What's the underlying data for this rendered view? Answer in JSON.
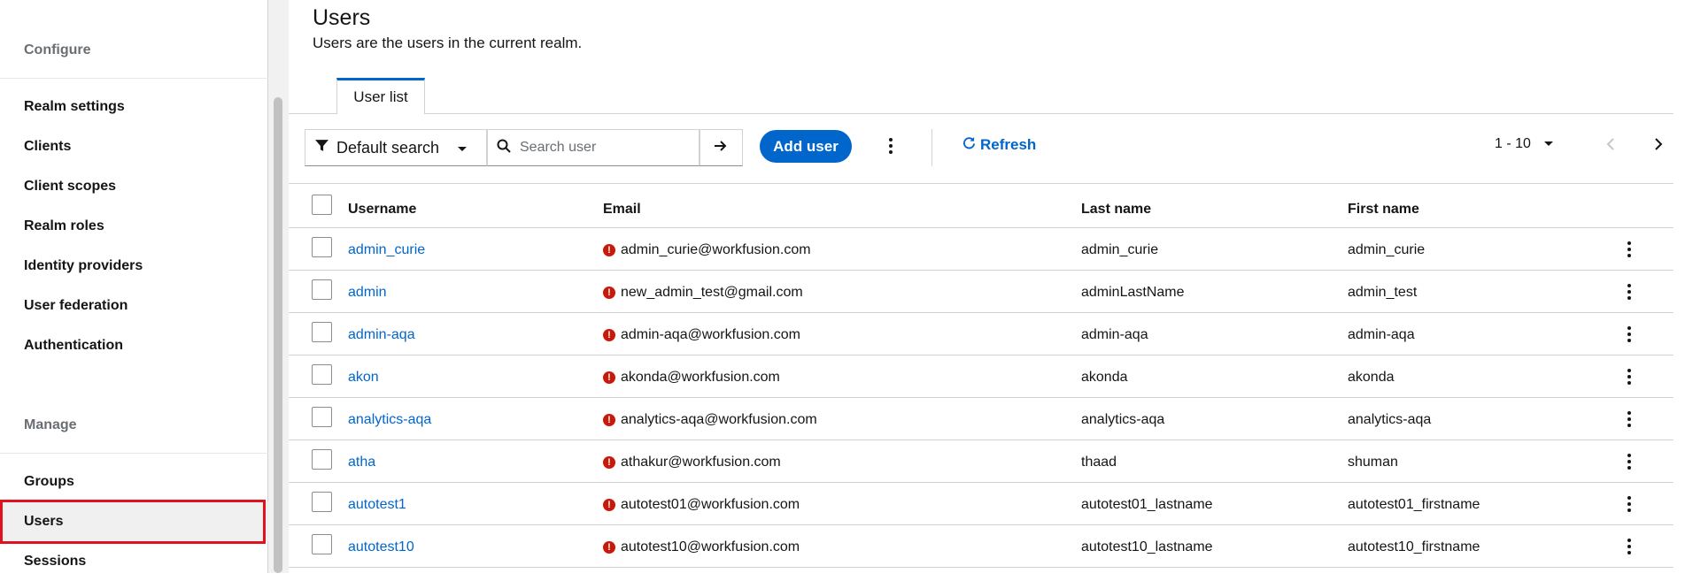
{
  "sidebar": {
    "configure_label": "Configure",
    "manage_label": "Manage",
    "configure_items": [
      {
        "label": "Realm settings"
      },
      {
        "label": "Clients"
      },
      {
        "label": "Client scopes"
      },
      {
        "label": "Realm roles"
      },
      {
        "label": "Identity providers"
      },
      {
        "label": "User federation"
      },
      {
        "label": "Authentication"
      }
    ],
    "manage_items": [
      {
        "label": "Groups"
      },
      {
        "label": "Users"
      },
      {
        "label": "Sessions"
      }
    ],
    "active_item": "Users"
  },
  "page": {
    "title": "Users",
    "subtitle": "Users are the users in the current realm."
  },
  "tabs": [
    {
      "label": "User list"
    }
  ],
  "toolbar": {
    "filter_label": "Default search",
    "search_placeholder": "Search user",
    "add_user_label": "Add user",
    "refresh_label": "Refresh",
    "pagination_label": "1 - 10"
  },
  "table": {
    "columns": [
      "Username",
      "Email",
      "Last name",
      "First name"
    ],
    "rows": [
      {
        "username": "admin_curie",
        "email": "admin_curie@workfusion.com",
        "last_name": "admin_curie",
        "first_name": "admin_curie"
      },
      {
        "username": "admin",
        "email": "new_admin_test@gmail.com",
        "last_name": "adminLastName",
        "first_name": "admin_test"
      },
      {
        "username": "admin-aqa",
        "email": "admin-aqa@workfusion.com",
        "last_name": "admin-aqa",
        "first_name": "admin-aqa"
      },
      {
        "username": "akon",
        "email": "akonda@workfusion.com",
        "last_name": "akonda",
        "first_name": "akonda"
      },
      {
        "username": "analytics-aqa",
        "email": "analytics-aqa@workfusion.com",
        "last_name": "analytics-aqa",
        "first_name": "analytics-aqa"
      },
      {
        "username": "atha",
        "email": "athakur@workfusion.com",
        "last_name": "thaad",
        "first_name": "shuman"
      },
      {
        "username": "autotest1",
        "email": "autotest01@workfusion.com",
        "last_name": "autotest01_lastname",
        "first_name": "autotest01_firstname"
      },
      {
        "username": "autotest10",
        "email": "autotest10@workfusion.com",
        "last_name": "autotest10_lastname",
        "first_name": "autotest10_firstname"
      }
    ]
  },
  "colors": {
    "accent": "#0066cc",
    "error": "#c9190b",
    "highlight": "#e0121e"
  },
  "icons": {
    "filter": "filter-icon",
    "search": "search-icon",
    "arrow": "arrow-right-icon",
    "refresh": "refresh-icon",
    "kebab": "kebab-icon",
    "caret": "caret-down-icon",
    "error": "exclamation-circle-icon"
  }
}
